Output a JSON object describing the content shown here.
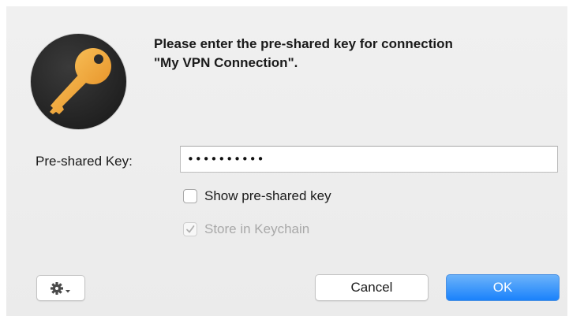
{
  "dialog": {
    "message_line1": "Please enter the pre-shared key for connection",
    "message_line2": "\"My VPN Connection\".",
    "icon": "key-icon"
  },
  "key_field": {
    "label": "Pre-shared Key:",
    "value": "••••••••••",
    "masked": true
  },
  "options": {
    "show_key": {
      "label": "Show pre-shared key",
      "checked": false,
      "enabled": true
    },
    "store_keychain": {
      "label": "Store in Keychain",
      "checked": true,
      "enabled": false
    }
  },
  "buttons": {
    "gear_icon": "gear-icon",
    "cancel_label": "Cancel",
    "ok_label": "OK"
  },
  "colors": {
    "accent": "#1a82fb",
    "key_gold": "#f0a83c",
    "icon_background": "#2b2b2b"
  }
}
